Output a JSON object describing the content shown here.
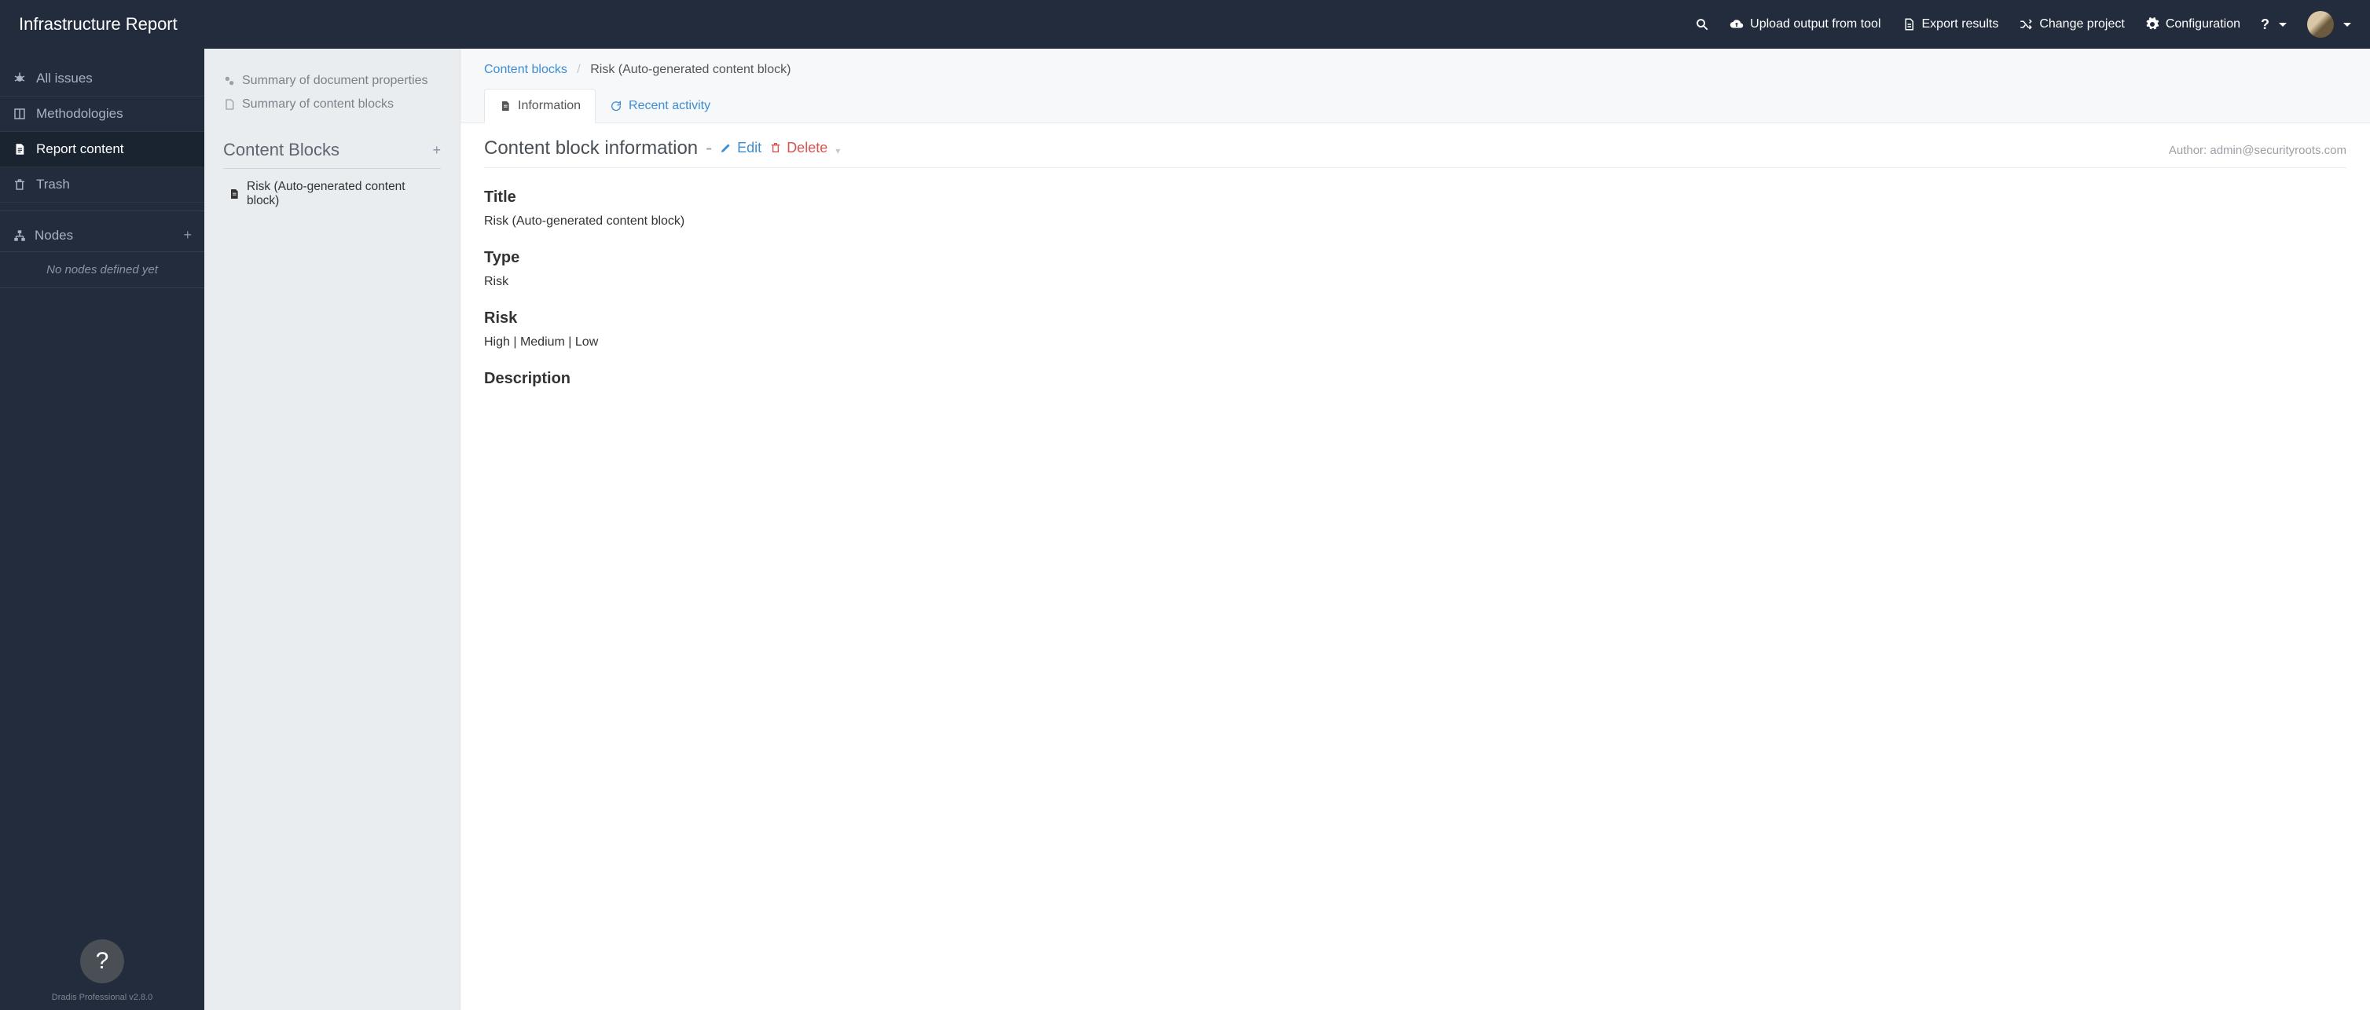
{
  "brand": "Infrastructure Report",
  "topnav": {
    "upload": "Upload output from tool",
    "export": "Export results",
    "change_project": "Change project",
    "configuration": "Configuration",
    "help": "?"
  },
  "sidebar": {
    "items": [
      {
        "label": "All issues"
      },
      {
        "label": "Methodologies"
      },
      {
        "label": "Report content"
      },
      {
        "label": "Trash"
      }
    ],
    "nodes_heading": "Nodes",
    "nodes_empty": "No nodes defined yet",
    "version": "Dradis Professional v2.8.0"
  },
  "panel2": {
    "summary_props": "Summary of document properties",
    "summary_blocks": "Summary of content blocks",
    "heading": "Content Blocks",
    "items": [
      {
        "label": "Risk (Auto-generated content block)"
      }
    ]
  },
  "breadcrumb": {
    "root": "Content blocks",
    "current": "Risk (Auto-generated content block)"
  },
  "tabs": {
    "info": "Information",
    "activity": "Recent activity"
  },
  "page": {
    "heading": "Content block information",
    "sep": "-",
    "edit": "Edit",
    "delete": "Delete",
    "author_label": "Author: ",
    "author": "admin@securityroots.com"
  },
  "fields": {
    "title_label": "Title",
    "title_value": "Risk (Auto-generated content block)",
    "type_label": "Type",
    "type_value": "Risk",
    "risk_label": "Risk",
    "risk_value": "High | Medium | Low",
    "description_label": "Description"
  }
}
